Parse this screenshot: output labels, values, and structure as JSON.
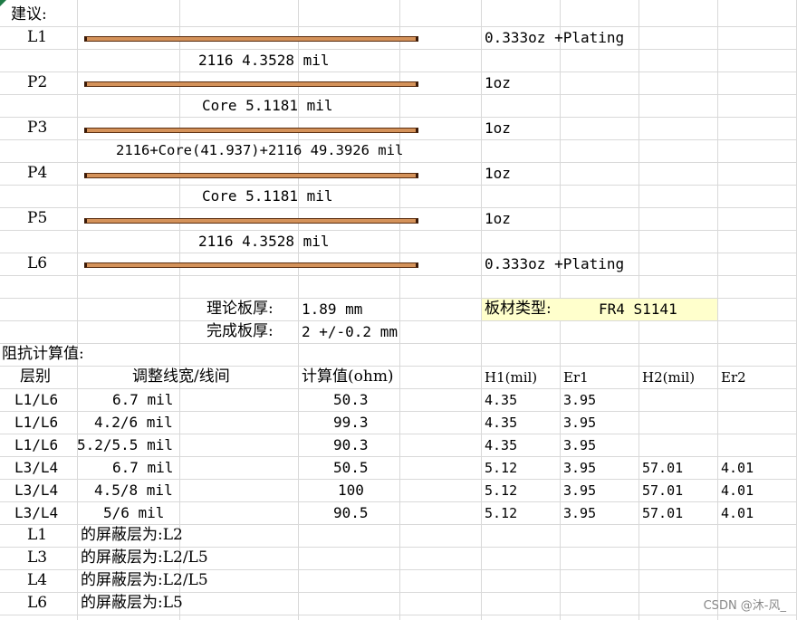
{
  "suggestion_label": "建议:",
  "stackup": [
    {
      "layer": "L1",
      "copper": "0.333oz +Plating"
    },
    {
      "dielectric": "2116     4.3528 mil"
    },
    {
      "layer": "P2",
      "copper": "1oz"
    },
    {
      "dielectric": "Core     5.1181 mil"
    },
    {
      "layer": "P3",
      "copper": "1oz"
    },
    {
      "dielectric": "2116+Core(41.937)+2116     49.3926 mil"
    },
    {
      "layer": "P4",
      "copper": "1oz"
    },
    {
      "dielectric": "Core     5.1181 mil"
    },
    {
      "layer": "P5",
      "copper": "1oz"
    },
    {
      "dielectric": "2116     4.3528 mil"
    },
    {
      "layer": "L6",
      "copper": "0.333oz +Plating"
    }
  ],
  "thickness": {
    "theory_label": "理论板厚:",
    "theory_value": "1.89 mm",
    "finished_label": "完成板厚:",
    "finished_value": "2 +/-0.2 mm",
    "material_label": "板材类型:",
    "material_value": "FR4 S1141"
  },
  "impedance": {
    "title": "阻抗计算值:",
    "headers": {
      "layer": "层别",
      "width": "调整线宽/线间",
      "calc": "计算值(ohm)",
      "h1": "H1(mil)",
      "er1": "Er1",
      "h2": "H2(mil)",
      "er2": "Er2"
    },
    "rows": [
      {
        "layer": "L1/L6",
        "width": "6.7 mil",
        "calc": "50.3",
        "h1": "4.35",
        "er1": "3.95",
        "h2": "",
        "er2": ""
      },
      {
        "layer": "L1/L6",
        "width": "4.2/6 mil",
        "calc": "99.3",
        "h1": "4.35",
        "er1": "3.95",
        "h2": "",
        "er2": ""
      },
      {
        "layer": "L1/L6",
        "width": "5.2/5.5 mil",
        "calc": "90.3",
        "h1": "4.35",
        "er1": "3.95",
        "h2": "",
        "er2": ""
      },
      {
        "layer": "L3/L4",
        "width": "6.7 mil",
        "calc": "50.5",
        "h1": "5.12",
        "er1": "3.95",
        "h2": "57.01",
        "er2": "4.01"
      },
      {
        "layer": "L3/L4",
        "width": "4.5/8 mil",
        "calc": "100",
        "h1": "5.12",
        "er1": "3.95",
        "h2": "57.01",
        "er2": "4.01"
      },
      {
        "layer": "L3/L4",
        "width": "5/6 mil",
        "calc": "90.5",
        "h1": "5.12",
        "er1": "3.95",
        "h2": "57.01",
        "er2": "4.01"
      }
    ]
  },
  "shields": [
    {
      "layer": "L1",
      "text": "的屏蔽层为:L2"
    },
    {
      "layer": "L3",
      "text": "的屏蔽层为:L2/L5"
    },
    {
      "layer": "L4",
      "text": "的屏蔽层为:L2/L5"
    },
    {
      "layer": "L6",
      "text": "的屏蔽层为:L5"
    }
  ],
  "watermark": "CSDN @沐-风_"
}
